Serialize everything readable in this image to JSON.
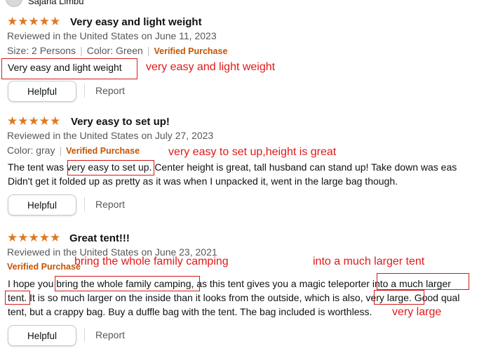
{
  "reviewer": {
    "name": "Sajana Limbu"
  },
  "reviews": [
    {
      "stars": "★★★★★",
      "title": "Very easy and light weight",
      "reviewed": "Reviewed in the United States on June 11, 2023",
      "size": "Size: 2 Persons",
      "color": "Color: Green",
      "verified": "Verified Purchase",
      "body": "Very easy and light weight",
      "helpful": "Helpful",
      "report": "Report",
      "note": "very easy and light weight"
    },
    {
      "stars": "★★★★★",
      "title": "Very easy to set up!",
      "reviewed": "Reviewed in the United States on July 27, 2023",
      "color": "Color: gray",
      "verified": "Verified Purchase",
      "body_line1": "The tent was very easy to set up. Center height is great, tall husband can stand up! Take down was eas",
      "body_line2": "Didn't get it folded up as pretty as it was when I unpacked it, went in the large bag though.",
      "helpful": "Helpful",
      "report": "Report",
      "note": "very easy to set up,height is great"
    },
    {
      "stars": "★★★★★",
      "title": "Great tent!!!",
      "reviewed": "Reviewed in the United States on June 23, 2021",
      "verified": "Verified Purchase",
      "body_line1": "I hope you bring the whole family camping, as this tent gives you a magic teleporter into a much larger",
      "body_line2": "tent. It is so much larger on the inside than it looks from the outside, which is also, very large. Good qual",
      "body_line3": "tent, but a crappy bag. Buy a duffle bag with the tent. The bag included is worthless.",
      "helpful": "Helpful",
      "report": "Report",
      "note_family": "bring the whole family camping",
      "note_larger": "into a much larger tent",
      "note_large": "very large"
    }
  ],
  "colors": {
    "star": "#de7921",
    "verified": "#c45500",
    "annotation": "#e01919",
    "meta": "#565959"
  }
}
